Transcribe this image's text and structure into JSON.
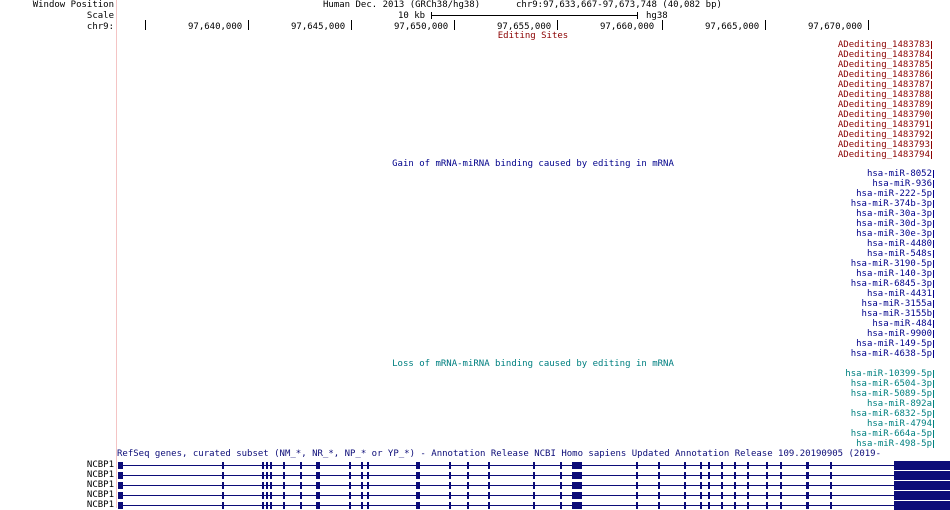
{
  "header": {
    "window_position_label": "Window Position",
    "scale_label": "Scale",
    "chr_label": "chr9:",
    "assembly": "Human Dec. 2013 (GRCh38/hg38)",
    "position": "chr9:97,633,667-97,673,748 (40,082 bp)",
    "scale_bar_value": "10 kb",
    "scale_bar_assembly": "hg38",
    "ticks": [
      "97,640,000",
      "97,645,000",
      "97,650,000",
      "97,655,000",
      "97,660,000",
      "97,665,000",
      "97,670,000"
    ]
  },
  "tracks": {
    "editing": {
      "title": "Editing Sites",
      "color": "#8b0000",
      "items": [
        "ADediting_1483783",
        "ADediting_1483784",
        "ADediting_1483785",
        "ADediting_1483786",
        "ADediting_1483787",
        "ADediting_1483788",
        "ADediting_1483789",
        "ADediting_1483790",
        "ADediting_1483791",
        "ADediting_1483792",
        "ADediting_1483793",
        "ADediting_1483794"
      ]
    },
    "gain": {
      "title": "Gain of mRNA-miRNA binding caused by editing in mRNA",
      "color": "#00008b",
      "items": [
        "hsa-miR-8052",
        "hsa-miR-936",
        "hsa-miR-222-5p",
        "hsa-miR-374b-3p",
        "hsa-miR-30a-3p",
        "hsa-miR-30d-3p",
        "hsa-miR-30e-3p",
        "hsa-miR-4480",
        "hsa-miR-548s",
        "hsa-miR-3190-5p",
        "hsa-miR-140-3p",
        "hsa-miR-6845-3p",
        "hsa-miR-4431",
        "hsa-miR-3155a",
        "hsa-miR-3155b",
        "hsa-miR-484",
        "hsa-miR-9900",
        "hsa-miR-149-5p",
        "hsa-miR-4638-5p"
      ]
    },
    "loss": {
      "title": "Loss of mRNA-miRNA binding caused by editing in mRNA",
      "color": "#008080",
      "items": [
        "hsa-miR-10399-5p",
        "hsa-miR-6504-3p",
        "hsa-miR-5089-5p",
        "hsa-miR-892a",
        "hsa-miR-6832-5p",
        "hsa-miR-4794",
        "hsa-miR-664a-5p",
        "hsa-miR-498-5p"
      ]
    },
    "genes": {
      "title": "RefSeq genes, curated subset (NM_*, NR_*, NP_* or YP_*) - Annotation Release NCBI Homo sapiens Updated Annotation Release 109.20190905 (2019-",
      "color": "#0c0c78",
      "gene_names": [
        "NCBP1",
        "NCBP1",
        "NCBP1",
        "NCBP1",
        "NCBP1"
      ]
    }
  }
}
